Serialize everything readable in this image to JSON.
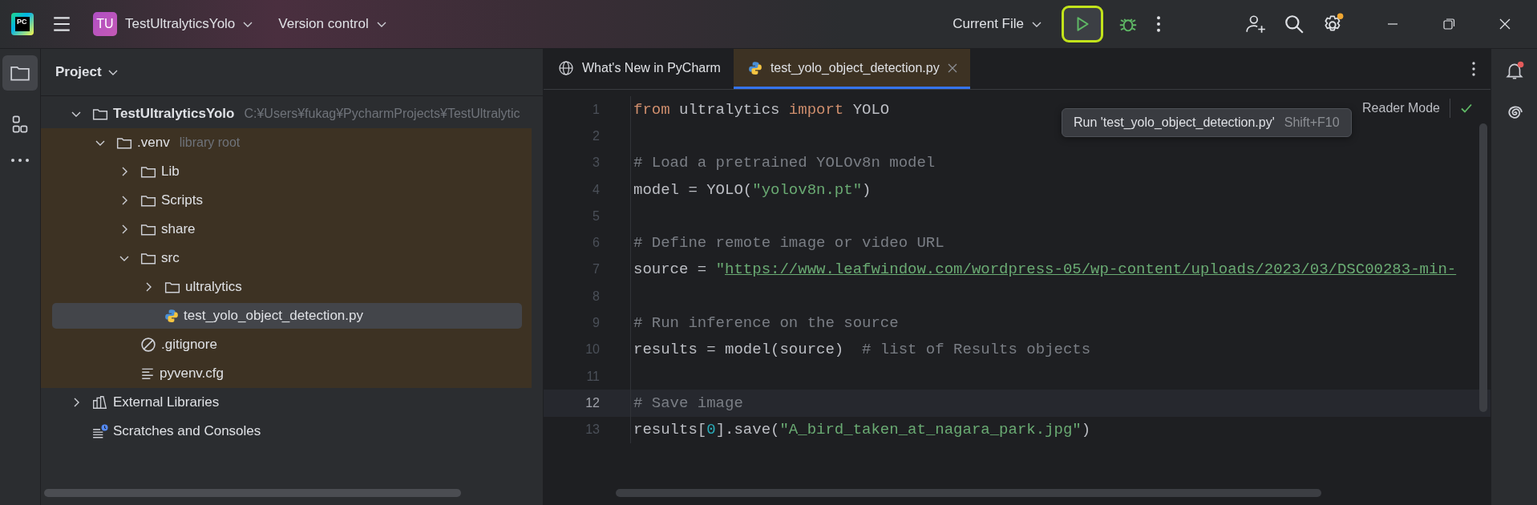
{
  "toolbar": {
    "logo": "PC",
    "project_badge": "TU",
    "project_name": "TestUltralyticsYolo",
    "vcs": "Version control",
    "run_config": "Current File",
    "run_button_highlighted": true
  },
  "tool_window": {
    "title": "Project"
  },
  "tree": [
    {
      "kind": "folder",
      "name": "TestUltralyticsYolo",
      "bold": true,
      "hint": "C:¥Users¥fukag¥PycharmProjects¥TestUltralytic",
      "expanded": true,
      "selected": false,
      "library": false,
      "children": [
        {
          "kind": "folder",
          "name": ".venv",
          "hint": "library root",
          "expanded": true,
          "selected": false,
          "library": true,
          "children": [
            {
              "kind": "folder",
              "name": "Lib",
              "expanded": false,
              "selected": false
            },
            {
              "kind": "folder",
              "name": "Scripts",
              "expanded": false,
              "selected": false
            },
            {
              "kind": "folder",
              "name": "share",
              "expanded": false,
              "selected": false
            },
            {
              "kind": "folder",
              "name": "src",
              "expanded": true,
              "selected": false,
              "children": [
                {
                  "kind": "folder",
                  "name": "ultralytics",
                  "expanded": false,
                  "selected": false
                },
                {
                  "kind": "python_file",
                  "name": "test_yolo_object_detection.py",
                  "selected": true
                }
              ]
            },
            {
              "kind": "ignore_file",
              "name": ".gitignore",
              "selected": false
            },
            {
              "kind": "config_file",
              "name": "pyvenv.cfg",
              "selected": false
            }
          ]
        }
      ]
    },
    {
      "kind": "libraries",
      "name": "External Libraries",
      "expanded": false,
      "selected": false,
      "library": false
    },
    {
      "kind": "scratches",
      "name": "Scratches and Consoles",
      "selected": false,
      "library": false
    }
  ],
  "tabs": [
    {
      "kind": "web",
      "label": "What's New in PyCharm",
      "selected": false,
      "closable": false
    },
    {
      "kind": "python_file",
      "label": "test_yolo_object_detection.py",
      "selected": true,
      "closable": true
    }
  ],
  "tooltip": {
    "text": "Run 'test_yolo_object_detection.py'",
    "shortcut": "Shift+F10"
  },
  "reader_mode": "Reader Mode",
  "editor": {
    "lines": [
      {
        "number": "1",
        "current": false,
        "tokens": [
          {
            "kind": "keyword",
            "text": "from"
          },
          {
            "kind": "plain",
            "text": " ultralytics "
          },
          {
            "kind": "keyword",
            "text": "import"
          },
          {
            "kind": "plain",
            "text": " YOLO"
          }
        ]
      },
      {
        "number": "2",
        "current": false
      },
      {
        "number": "3",
        "current": false,
        "tokens": [
          {
            "kind": "comment",
            "text": "# Load a pretrained YOLOv8n model"
          }
        ]
      },
      {
        "number": "4",
        "current": false,
        "tokens": [
          {
            "kind": "plain",
            "text": "model = YOLO("
          },
          {
            "kind": "string",
            "text": "\"yolov8n.pt\""
          },
          {
            "kind": "plain",
            "text": ")"
          }
        ]
      },
      {
        "number": "5",
        "current": false
      },
      {
        "number": "6",
        "current": false,
        "tokens": [
          {
            "kind": "comment",
            "text": "# Define remote image or video URL"
          }
        ]
      },
      {
        "number": "7",
        "current": false,
        "tokens": [
          {
            "kind": "plain",
            "text": "source = "
          },
          {
            "kind": "string",
            "text": "\""
          },
          {
            "kind": "link",
            "text": "https://www.leafwindow.com/wordpress-05/wp-content/uploads/2023/03/DSC00283-min-"
          }
        ]
      },
      {
        "number": "8",
        "current": false
      },
      {
        "number": "9",
        "current": false,
        "tokens": [
          {
            "kind": "comment",
            "text": "# Run inference on the source"
          }
        ]
      },
      {
        "number": "10",
        "current": false,
        "tokens": [
          {
            "kind": "plain",
            "text": "results = model(source)  "
          },
          {
            "kind": "comment",
            "text": "# list of Results objects"
          }
        ]
      },
      {
        "number": "11",
        "current": false
      },
      {
        "number": "12",
        "current": true,
        "tokens": [
          {
            "kind": "comment",
            "text": "# Save image"
          }
        ]
      },
      {
        "number": "13",
        "current": false,
        "tokens": [
          {
            "kind": "plain",
            "text": "results["
          },
          {
            "kind": "number",
            "text": "0"
          },
          {
            "kind": "plain",
            "text": "].save("
          },
          {
            "kind": "string",
            "text": "\"A_bird_taken_at_nagara_park.jpg\""
          },
          {
            "kind": "plain",
            "text": ")"
          }
        ]
      }
    ]
  }
}
